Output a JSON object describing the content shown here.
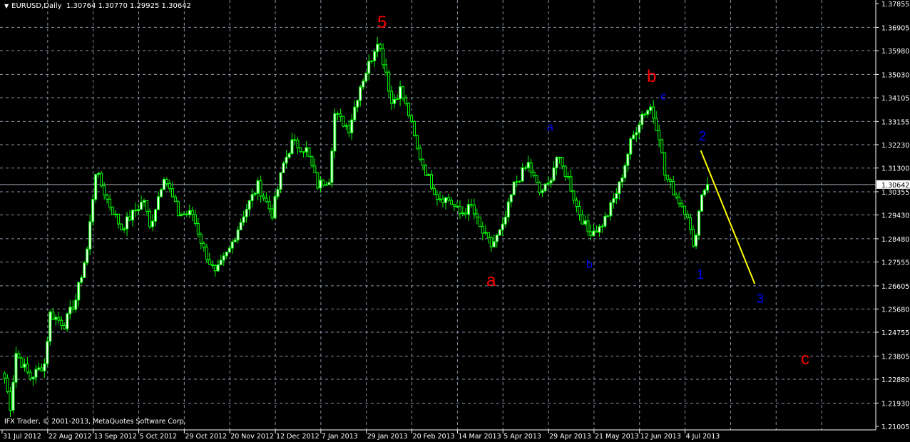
{
  "header": {
    "symbol": "EURUSD,Daily",
    "ohlc": "1.30764 1.30770 1.29925 1.30642"
  },
  "copyright": "IFX Trader, © 2001-2013, MetaQuotes Software Corp.",
  "colors": {
    "background": "#000000",
    "bull": "#00ff00",
    "grid": "#8a96a8",
    "yellow_line": "#ffff00",
    "red_labels": "#ff0000",
    "blue_labels": "#0000ff"
  },
  "wave_labels": {
    "red": {
      "five": "5",
      "a": "a",
      "b": "b",
      "c": "c"
    },
    "blue": {
      "a": "a",
      "b": "b",
      "c": "c",
      "one": "1",
      "two": "2",
      "three": "3"
    }
  },
  "chart_data": {
    "type": "candlestick",
    "title": "EURUSD,Daily",
    "current_price": 1.30642,
    "current_price_label": "1.30642",
    "ylim": [
      1.21005,
      1.37855
    ],
    "y_ticks": [
      "1.37855",
      "1.36905",
      "1.35980",
      "1.35030",
      "1.34105",
      "1.33155",
      "1.32230",
      "1.31300",
      "1.30355",
      "1.29430",
      "1.28480",
      "1.27555",
      "1.26605",
      "1.25680",
      "1.24755",
      "1.23805",
      "1.22880",
      "1.21930",
      "1.21005"
    ],
    "x_ticks": [
      "31 Jul 2012",
      "22 Aug 2012",
      "13 Sep 2012",
      "5 Oct 2012",
      "29 Oct 2012",
      "20 Nov 2012",
      "12 Dec 2012",
      "7 Jan 2013",
      "29 Jan 2013",
      "20 Feb 2013",
      "14 Mar 2013",
      "5 Apr 2013",
      "29 Apr 2013",
      "21 May 2013",
      "12 Jun 2013",
      "4 Jul 2013"
    ],
    "bars_per_x_tick": 16,
    "close_keypoints": [
      [
        0,
        1.2293
      ],
      [
        2,
        1.218
      ],
      [
        4,
        1.2393
      ],
      [
        9,
        1.2293
      ],
      [
        14,
        1.235
      ],
      [
        16,
        1.2549
      ],
      [
        21,
        1.2507
      ],
      [
        25,
        1.2606
      ],
      [
        29,
        1.2805
      ],
      [
        32,
        1.3118
      ],
      [
        36,
        1.3004
      ],
      [
        41,
        1.289
      ],
      [
        45,
        1.2947
      ],
      [
        49,
        1.3004
      ],
      [
        51,
        1.289
      ],
      [
        56,
        1.3103
      ],
      [
        61,
        1.2947
      ],
      [
        66,
        1.2947
      ],
      [
        70,
        1.2805
      ],
      [
        74,
        1.2706
      ],
      [
        79,
        1.2805
      ],
      [
        84,
        1.2947
      ],
      [
        89,
        1.3061
      ],
      [
        94,
        1.2947
      ],
      [
        98,
        1.3146
      ],
      [
        101,
        1.3231
      ],
      [
        106,
        1.3203
      ],
      [
        110,
        1.3061
      ],
      [
        114,
        1.3089
      ],
      [
        116,
        1.3345
      ],
      [
        121,
        1.3288
      ],
      [
        125,
        1.3459
      ],
      [
        129,
        1.3572
      ],
      [
        131,
        1.3643
      ],
      [
        134,
        1.3516
      ],
      [
        136,
        1.3388
      ],
      [
        139,
        1.3444
      ],
      [
        142,
        1.3345
      ],
      [
        145,
        1.3203
      ],
      [
        149,
        1.3089
      ],
      [
        152,
        1.3018
      ],
      [
        156,
        1.3004
      ],
      [
        160,
        1.2947
      ],
      [
        164,
        1.2976
      ],
      [
        167,
        1.289
      ],
      [
        171,
        1.2819
      ],
      [
        175,
        1.289
      ],
      [
        179,
        1.3061
      ],
      [
        184,
        1.3146
      ],
      [
        188,
        1.3032
      ],
      [
        191,
        1.3061
      ],
      [
        194,
        1.3174
      ],
      [
        198,
        1.3089
      ],
      [
        201,
        1.2976
      ],
      [
        205,
        1.2876
      ],
      [
        209,
        1.289
      ],
      [
        212,
        1.2947
      ],
      [
        216,
        1.3061
      ],
      [
        220,
        1.3231
      ],
      [
        224,
        1.3345
      ],
      [
        227,
        1.3373
      ],
      [
        230,
        1.326
      ],
      [
        232,
        1.3103
      ],
      [
        236,
        1.3018
      ],
      [
        240,
        1.2947
      ],
      [
        242,
        1.2805
      ],
      [
        245,
        1.3032
      ],
      [
        247,
        1.3064
      ]
    ],
    "trendline": {
      "from": [
        245,
        1.32
      ],
      "to": [
        264,
        1.2668
      ]
    }
  }
}
